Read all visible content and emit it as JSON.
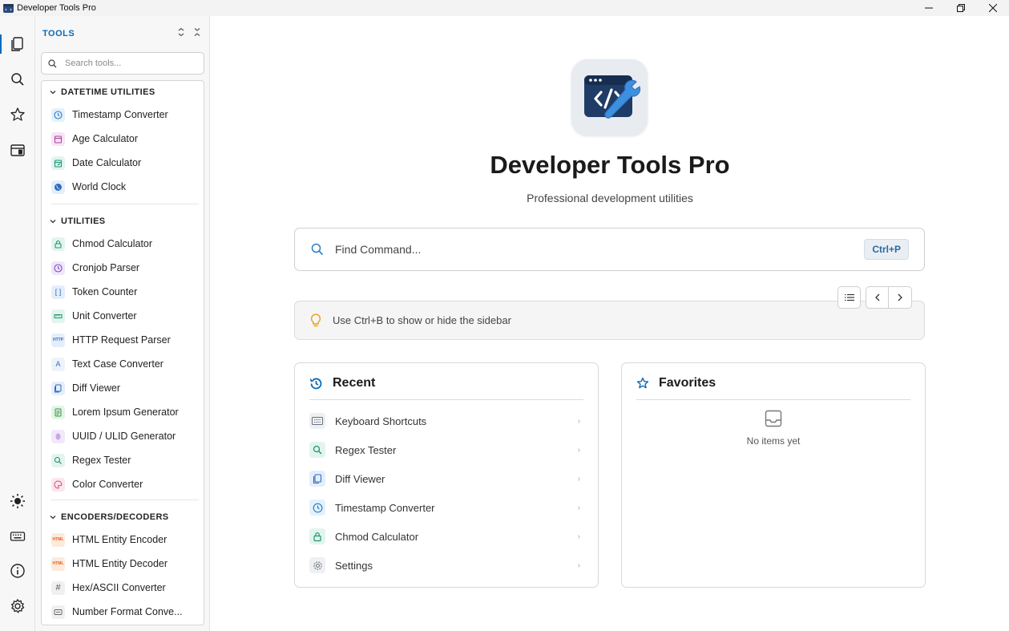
{
  "window": {
    "title": "Developer Tools Pro"
  },
  "sidebar": {
    "header": "TOOLS",
    "search_placeholder": "Search tools...",
    "sections": [
      {
        "title": "DATETIME UTILITIES",
        "items": [
          {
            "label": "Timestamp Converter",
            "icon": "clock-icon"
          },
          {
            "label": "Age Calculator",
            "icon": "calendar-icon"
          },
          {
            "label": "Date Calculator",
            "icon": "calendar-edit-icon"
          },
          {
            "label": "World Clock",
            "icon": "globe-icon"
          }
        ]
      },
      {
        "title": "UTILITIES",
        "items": [
          {
            "label": "Chmod Calculator",
            "icon": "lock-icon"
          },
          {
            "label": "Cronjob Parser",
            "icon": "clock-icon"
          },
          {
            "label": "Token Counter",
            "icon": "brackets-icon"
          },
          {
            "label": "Unit Converter",
            "icon": "ruler-icon"
          },
          {
            "label": "HTTP Request Parser",
            "icon": "http-icon"
          },
          {
            "label": "Text Case Converter",
            "icon": "text-case-icon"
          },
          {
            "label": "Diff Viewer",
            "icon": "diff-icon"
          },
          {
            "label": "Lorem Ipsum Generator",
            "icon": "document-icon"
          },
          {
            "label": "UUID / ULID Generator",
            "icon": "fingerprint-icon"
          },
          {
            "label": "Regex Tester",
            "icon": "search-icon"
          },
          {
            "label": "Color Converter",
            "icon": "palette-icon"
          }
        ]
      },
      {
        "title": "ENCODERS/DECODERS",
        "items": [
          {
            "label": "HTML Entity Encoder",
            "icon": "html-icon"
          },
          {
            "label": "HTML Entity Decoder",
            "icon": "html-icon"
          },
          {
            "label": "Hex/ASCII Converter",
            "icon": "hash-icon"
          },
          {
            "label": "Number Format Conve...",
            "icon": "number-icon"
          }
        ]
      }
    ]
  },
  "main": {
    "title": "Developer Tools Pro",
    "subtitle": "Professional development utilities",
    "command": {
      "placeholder": "Find Command...",
      "shortcut": "Ctrl+P"
    },
    "tip": "Use Ctrl+B to show or hide the sidebar",
    "recent": {
      "title": "Recent",
      "items": [
        {
          "label": "Keyboard Shortcuts",
          "icon": "keyboard-icon"
        },
        {
          "label": "Regex Tester",
          "icon": "search-icon"
        },
        {
          "label": "Diff Viewer",
          "icon": "diff-icon"
        },
        {
          "label": "Timestamp Converter",
          "icon": "clock-icon"
        },
        {
          "label": "Chmod Calculator",
          "icon": "lock-icon"
        },
        {
          "label": "Settings",
          "icon": "gear-icon"
        }
      ]
    },
    "favorites": {
      "title": "Favorites",
      "empty_text": "No items yet"
    }
  },
  "colors": {
    "accent": "#0a6ab8",
    "sidebar_bg": "#f7f7f7",
    "tip_bulb": "#e8a317"
  }
}
